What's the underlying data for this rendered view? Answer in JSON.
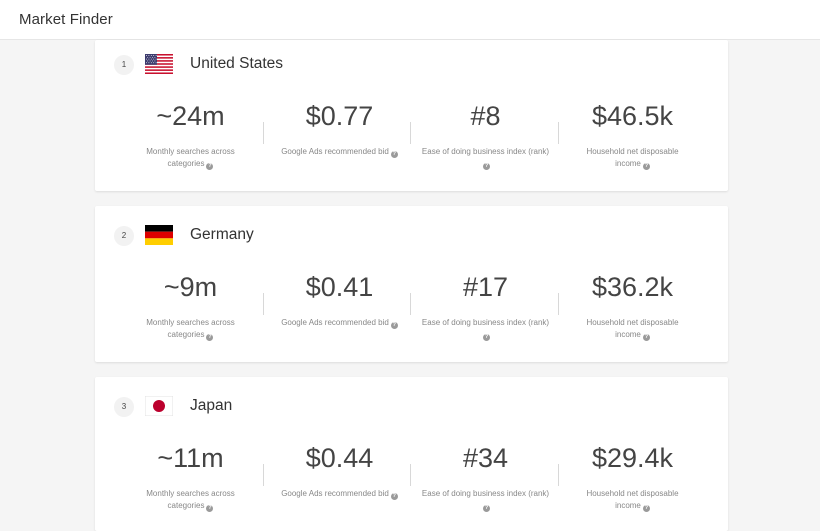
{
  "app": {
    "title": "Market Finder"
  },
  "markets": [
    {
      "rank": "1",
      "country": "United States",
      "flag": "us-flag-icon",
      "searches": "~24m",
      "bid": "$0.77",
      "ease_rank": "#8",
      "income": "$46.5k"
    },
    {
      "rank": "2",
      "country": "Germany",
      "flag": "de-flag-icon",
      "searches": "~9m",
      "bid": "$0.41",
      "ease_rank": "#17",
      "income": "$36.2k"
    },
    {
      "rank": "3",
      "country": "Japan",
      "flag": "jp-flag-icon",
      "searches": "~11m",
      "bid": "$0.44",
      "ease_rank": "#34",
      "income": "$29.4k"
    }
  ],
  "labels": {
    "searches": "Monthly searches across categories",
    "bid": "Google Ads recommended bid",
    "ease": "Ease of doing business index (rank)",
    "income": "Household net disposable income"
  },
  "icons": {
    "info": "help-icon",
    "info_glyph": "?"
  },
  "colors": {
    "flag_red": "#c8102e",
    "flag_blue": "#3c3b6e",
    "de_gold": "#ffce00",
    "jp_red": "#bc002d"
  }
}
